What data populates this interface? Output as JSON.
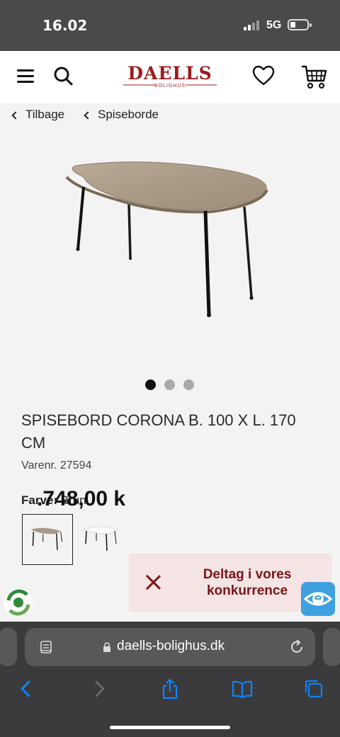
{
  "status_bar": {
    "time": "16.02",
    "network": "5G"
  },
  "header": {
    "logo_text": "DAELLS",
    "logo_subtext": "BOLIGHUS"
  },
  "breadcrumb": {
    "back_label": "Tilbage",
    "category_label": "Spiseborde"
  },
  "carousel": {
    "total": 3,
    "active_index": 0
  },
  "product": {
    "title": "SPISEBORD CORONA B. 100 X L. 170 CM",
    "sku": "Varenr. 27594",
    "color_label": "Farve:",
    "color_value": "Brun",
    "price": ".748,00 k"
  },
  "promo": {
    "text": "Deltag i vores konkurrence"
  },
  "browser": {
    "url": "daells-bolighus.dk"
  },
  "icons": {
    "menu": "menu-icon",
    "search": "search-icon",
    "wishlist": "heart-icon",
    "cart": "cart-icon",
    "close": "close-icon",
    "eye": "eye-icon",
    "back": "chevron-left-icon",
    "forward": "chevron-right-icon",
    "share": "share-icon",
    "bookmarks": "book-icon",
    "tabs": "tabs-icon",
    "reload": "reload-icon",
    "lock": "lock-icon",
    "reader": "reader-icon"
  },
  "colors": {
    "brand": "#9b1b1f",
    "promo_bg": "#f4e4e4",
    "promo_text": "#7a1518",
    "safari_blue": "#0a84ff"
  }
}
